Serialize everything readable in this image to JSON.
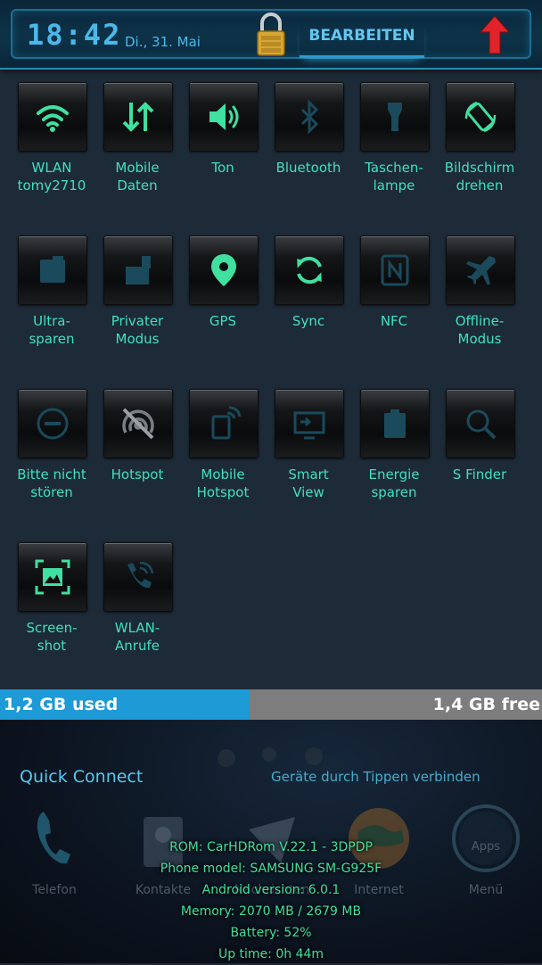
{
  "status": {
    "time": "18:42",
    "date": "Di., 31. Mai",
    "edit_label": "BEARBEITEN"
  },
  "tiles": [
    {
      "label": "WLAN\ntomy2710",
      "icon": "wifi-icon",
      "active": true
    },
    {
      "label": "Mobile\nDaten",
      "icon": "mobile-data-icon",
      "active": true
    },
    {
      "label": "Ton",
      "icon": "sound-icon",
      "active": true
    },
    {
      "label": "Bluetooth",
      "icon": "bluetooth-icon",
      "active": false
    },
    {
      "label": "Taschen-\nlampe",
      "icon": "flashlight-icon",
      "active": false
    },
    {
      "label": "Bildschirm\ndrehen",
      "icon": "rotate-screen-icon",
      "active": true
    },
    {
      "label": "Ultra-\nsparen",
      "icon": "ultra-power-saving-icon",
      "active": false
    },
    {
      "label": "Privater\nModus",
      "icon": "private-mode-icon",
      "active": false
    },
    {
      "label": "GPS",
      "icon": "gps-icon",
      "active": true
    },
    {
      "label": "Sync",
      "icon": "sync-icon",
      "active": true
    },
    {
      "label": "NFC",
      "icon": "nfc-icon",
      "active": false
    },
    {
      "label": "Offline-\nModus",
      "icon": "airplane-icon",
      "active": false
    },
    {
      "label": "Bitte nicht\nstören",
      "icon": "do-not-disturb-icon",
      "active": false
    },
    {
      "label": "Hotspot",
      "icon": "hotspot-icon",
      "active": false
    },
    {
      "label": "Mobile\nHotspot",
      "icon": "mobile-hotspot-icon",
      "active": false
    },
    {
      "label": "Smart\nView",
      "icon": "smart-view-icon",
      "active": false
    },
    {
      "label": "Energie\nsparen",
      "icon": "power-saving-icon",
      "active": false
    },
    {
      "label": "S Finder",
      "icon": "search-icon",
      "active": false
    },
    {
      "label": "Screen-\nshot",
      "icon": "screenshot-icon",
      "active": true
    },
    {
      "label": "WLAN-\nAnrufe",
      "icon": "wifi-calling-icon",
      "active": false
    }
  ],
  "memory": {
    "used_label": "1,2 GB used",
    "free_label": "1,4 GB free",
    "used_fraction": 0.46
  },
  "quick_connect": {
    "title": "Quick Connect",
    "hint": "Geräte durch Tippen verbinden"
  },
  "dock": [
    {
      "label": "Telefon",
      "icon": "phone-icon"
    },
    {
      "label": "Kontakte",
      "icon": "contacts-icon"
    },
    {
      "label": "Nachrichten",
      "icon": "messages-icon"
    },
    {
      "label": "Internet",
      "icon": "globe-icon"
    },
    {
      "label": "Menü",
      "icon": "apps-icon",
      "badge": "Apps"
    }
  ],
  "sysinfo": {
    "rom": "ROM: CarHDRom V.22.1 - 3DPDP",
    "model": "Phone model: SAMSUNG SM-G925F",
    "android": "Android version: 6.0.1",
    "memory": "Memory: 2070 MB / 2679 MB",
    "battery": "Battery: 52%",
    "uptime": "Up time: 0h 44m"
  },
  "colors": {
    "accent": "#3fe0a0",
    "header_blue": "#4ab8ea",
    "mem_used": "#1e9ad6",
    "mem_free": "#7d7d7d"
  }
}
